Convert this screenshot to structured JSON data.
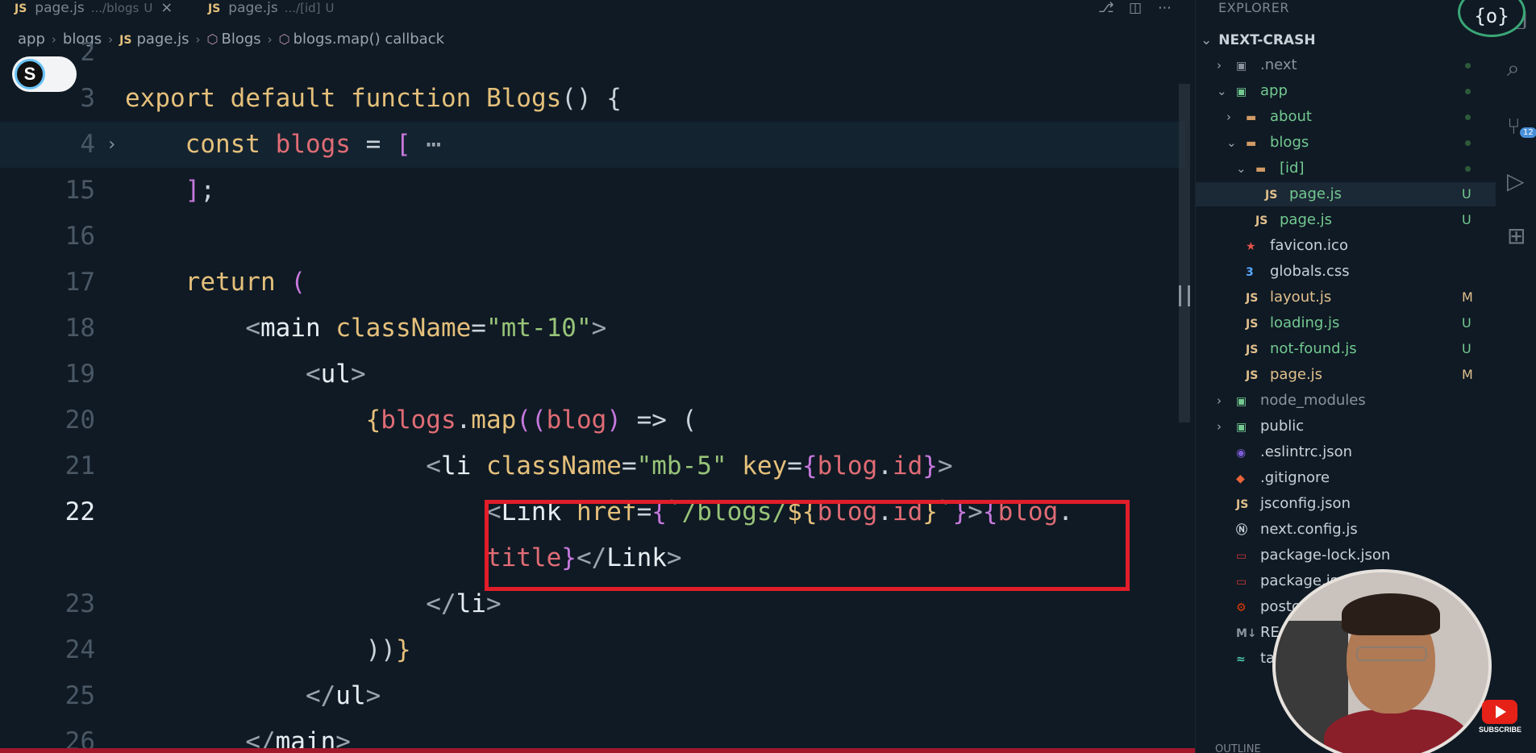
{
  "tabs": [
    {
      "label": "page.js",
      "path": ".../blogs",
      "status": "U",
      "close": "×"
    },
    {
      "label": "page.js",
      "path": ".../[id]",
      "status": "U"
    }
  ],
  "breadcrumb": [
    "app",
    "blogs",
    "page.js",
    "Blogs",
    "blogs.map() callback"
  ],
  "toggle_letter": "S",
  "code": {
    "ln3": "3",
    "ln4": "4",
    "ln15": "15",
    "ln16": "16",
    "ln17": "17",
    "ln18": "18",
    "ln19": "19",
    "ln20": "20",
    "ln21": "21",
    "ln22": "22",
    "ln23": "23",
    "ln24": "24",
    "ln25": "25",
    "ln26": "26",
    "ln2": "2"
  },
  "explorer": {
    "title": "EXPLORER",
    "project": "NEXT-CRASH",
    "items": [
      {
        "label": ".next",
        "status": ""
      },
      {
        "label": "app",
        "status": ""
      },
      {
        "label": "about",
        "status": ""
      },
      {
        "label": "blogs",
        "status": ""
      },
      {
        "label": "[id]",
        "status": ""
      },
      {
        "label": "page.js",
        "status": "U"
      },
      {
        "label": "page.js",
        "status": "U"
      },
      {
        "label": "favicon.ico",
        "status": ""
      },
      {
        "label": "globals.css",
        "status": ""
      },
      {
        "label": "layout.js",
        "status": "M"
      },
      {
        "label": "loading.js",
        "status": "U"
      },
      {
        "label": "not-found.js",
        "status": "U"
      },
      {
        "label": "page.js",
        "status": "M"
      },
      {
        "label": "node_modules",
        "status": ""
      },
      {
        "label": "public",
        "status": ""
      },
      {
        "label": ".eslintrc.json",
        "status": ""
      },
      {
        "label": ".gitignore",
        "status": ""
      },
      {
        "label": "jsconfig.json",
        "status": ""
      },
      {
        "label": "next.config.js",
        "status": ""
      },
      {
        "label": "package-lock.json",
        "status": ""
      },
      {
        "label": "package.json",
        "status": ""
      },
      {
        "label": "postcs",
        "status": ""
      },
      {
        "label": "REA",
        "status": ""
      },
      {
        "label": "tai",
        "status": ""
      }
    ],
    "outline": "OUTLINE"
  },
  "badge": "12",
  "logo": "{o}",
  "subscribe": "SUBSCRIBE",
  "colors": {
    "highlight_box": "#e11d2a",
    "untracked": "#73c991",
    "modified": "#e2c08d"
  }
}
